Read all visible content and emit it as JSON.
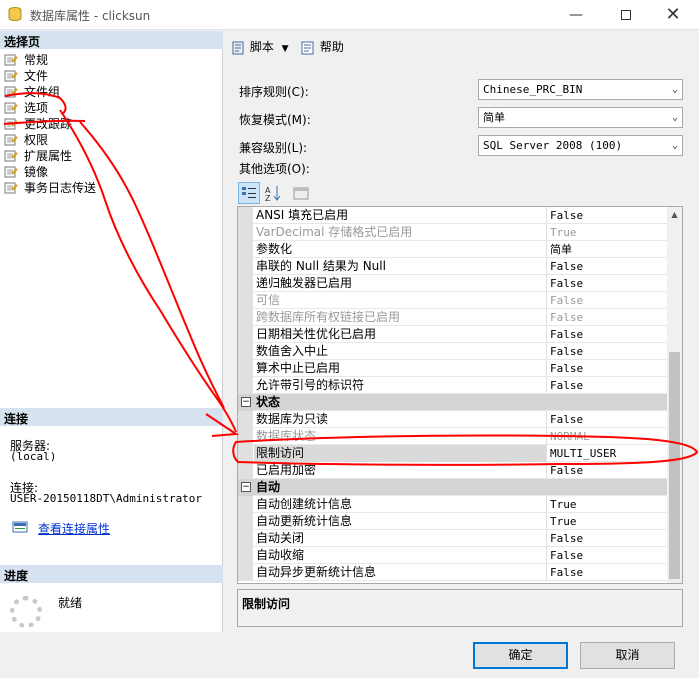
{
  "window": {
    "title": "数据库属性 - clicksun"
  },
  "left": {
    "select_page_header": "选择页",
    "pages": [
      "常规",
      "文件",
      "文件组",
      "选项",
      "更改跟踪",
      "权限",
      "扩展属性",
      "镜像",
      "事务日志传送"
    ],
    "connection_header": "连接",
    "server_label": "服务器:",
    "server_value": "(local)",
    "connection_label": "连接:",
    "connection_value": "USER-20150118DT\\Administrator",
    "view_link": "查看连接属性",
    "progress_header": "进度",
    "progress_status": "就绪"
  },
  "toolbar": {
    "script_label": "脚本",
    "help_label": "帮助"
  },
  "form": {
    "collation_label": "排序规则(C):",
    "collation_value": "Chinese_PRC_BIN",
    "recovery_label": "恢复模式(M):",
    "recovery_value": "简单",
    "compat_label": "兼容级别(L):",
    "compat_value": "SQL Server 2008 (100)",
    "other_label": "其他选项(O):"
  },
  "grid_rows": [
    {
      "kind": "prop",
      "name": "ANSI 填充已启用",
      "value": "False"
    },
    {
      "kind": "prop",
      "name": "VarDecimal 存储格式已启用",
      "value": "True",
      "disabled": true
    },
    {
      "kind": "prop",
      "name": "参数化",
      "value": "简单"
    },
    {
      "kind": "prop",
      "name": "串联的 Null 结果为 Null",
      "value": "False"
    },
    {
      "kind": "prop",
      "name": "递归触发器已启用",
      "value": "False"
    },
    {
      "kind": "prop",
      "name": "可信",
      "value": "False",
      "disabled": true
    },
    {
      "kind": "prop",
      "name": "跨数据库所有权链接已启用",
      "value": "False",
      "disabled": true
    },
    {
      "kind": "prop",
      "name": "日期相关性优化已启用",
      "value": "False"
    },
    {
      "kind": "prop",
      "name": "数值舍入中止",
      "value": "False"
    },
    {
      "kind": "prop",
      "name": "算术中止已启用",
      "value": "False"
    },
    {
      "kind": "prop",
      "name": "允许带引号的标识符",
      "value": "False"
    },
    {
      "kind": "cat",
      "name": "状态",
      "value": ""
    },
    {
      "kind": "prop",
      "name": "数据库为只读",
      "value": "False"
    },
    {
      "kind": "prop",
      "name": "数据库状态",
      "value": "NORMAL",
      "disabled": true
    },
    {
      "kind": "prop",
      "name": "限制访问",
      "value": "MULTI_USER",
      "selected": true
    },
    {
      "kind": "prop",
      "name": "已启用加密",
      "value": "False"
    },
    {
      "kind": "cat",
      "name": "自动",
      "value": ""
    },
    {
      "kind": "prop",
      "name": "自动创建统计信息",
      "value": "True"
    },
    {
      "kind": "prop",
      "name": "自动更新统计信息",
      "value": "True"
    },
    {
      "kind": "prop",
      "name": "自动关闭",
      "value": "False"
    },
    {
      "kind": "prop",
      "name": "自动收缩",
      "value": "False"
    },
    {
      "kind": "prop",
      "name": "自动异步更新统计信息",
      "value": "False"
    }
  ],
  "description": {
    "title": "限制访问"
  },
  "buttons": {
    "ok": "确定",
    "cancel": "取消"
  },
  "colors": {
    "section_header": "#d6e2f0",
    "annotation": "#ff0000",
    "link": "#0033cc",
    "ok_border": "#0078d7"
  },
  "icons": [
    "database-icon",
    "minimize-icon",
    "maximize-icon",
    "close-icon",
    "page-icon",
    "script-icon",
    "dropdown-icon",
    "help-icon",
    "categorized-icon",
    "alphabetical-icon",
    "property-pages-icon",
    "link-icon",
    "spinner-icon"
  ]
}
